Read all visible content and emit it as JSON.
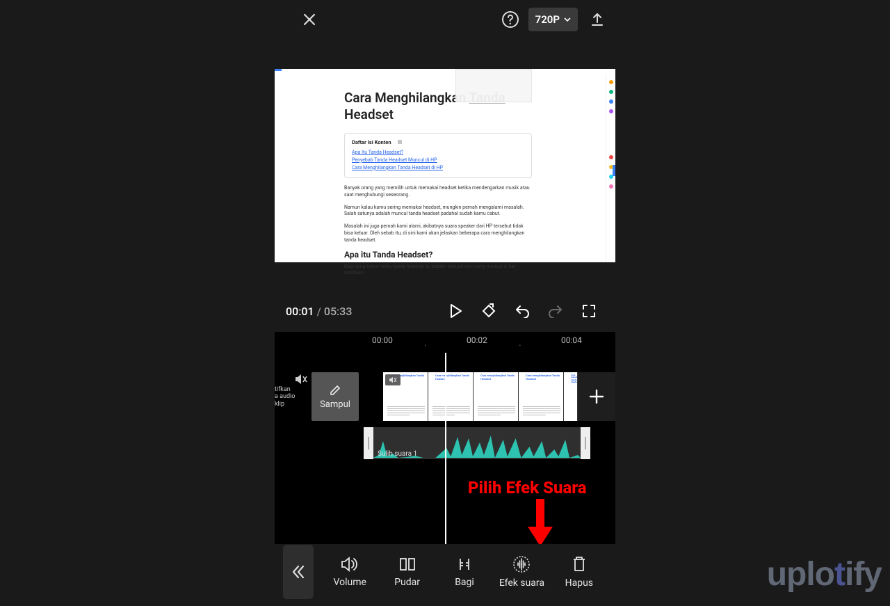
{
  "topbar": {
    "quality_label": "720P"
  },
  "preview": {
    "title_a": "Cara Menghilangkan ",
    "title_b": "Tanda",
    "title_c": "Headset",
    "toc_title": "Daftar Isi Konten",
    "toc_items": [
      "Apa Itu Tanda Headset?",
      "Penyebab Tanda Headset Muncul di HP",
      "Cara Menghilangkan Tanda Headset di HP"
    ],
    "p1": "Banyak orang yang memilih untuk memakai headset ketika mendengarkan musik atau saat menghubungi seseorang.",
    "p2": "Namun kalau kamu sering memakai headset, mungkin pernah mengalami masalah. Salah satunya adalah muncul tanda headset padahal sudah kamu cabut.",
    "p3": "Masalah ini juga pernah kami alami, akibatnya suara speaker dari HP tersebut tidak bisa keluar. Oleh sebab itu, di sini kami akan jelaskan beberapa cara menghilangkan tanda headset.",
    "h2": "Apa itu Tanda Headset?",
    "p4": "Bagi yang belum tahu, tanda headset itu adalah sebuah ikon yang muncul di bar notifikasi"
  },
  "transport": {
    "current": "00:01",
    "duration": "05:33"
  },
  "timeline": {
    "ruler": [
      "00:00",
      "00:02",
      "00:04"
    ],
    "mute_text": "tifkan\na audio\nklip",
    "sampul": "Sampul",
    "clip_title": "Cara menghilangkan Tanda Headset",
    "audio_label": "Sulih suara 1"
  },
  "annotation": {
    "text": "Pilih Efek Suara"
  },
  "tools": {
    "volume": "Volume",
    "pudar": "Pudar",
    "bagi": "Bagi",
    "efek": "Efek suara",
    "hapus": "Hapus"
  },
  "watermark": {
    "a": "uplo",
    "b": "t",
    "c": "ify"
  }
}
